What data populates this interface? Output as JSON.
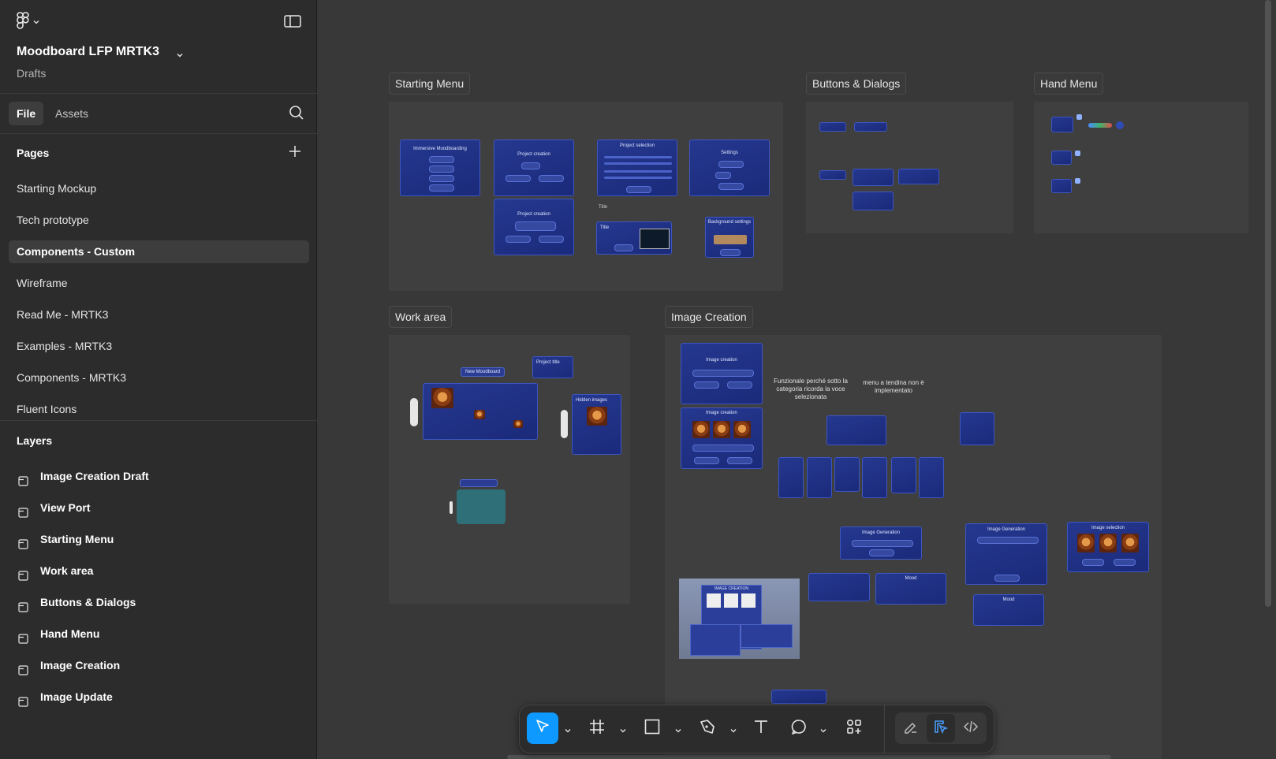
{
  "file": {
    "title": "Moodboard LFP MRTK3",
    "location": "Drafts"
  },
  "tabs": {
    "file": "File",
    "assets": "Assets"
  },
  "pages": {
    "heading": "Pages",
    "items": [
      "Starting Mockup",
      "Tech prototype",
      "Components - Custom",
      "Wireframe",
      "Read Me - MRTK3",
      "Examples - MRTK3",
      "Components -  MRTK3",
      "Fluent Icons"
    ],
    "selected": "Components - Custom"
  },
  "layers": {
    "heading": "Layers",
    "items": [
      "Image Creation Draft",
      "View Port",
      "Starting Menu",
      "Work area",
      "Buttons & Dialogs",
      "Hand Menu",
      "Image Creation",
      "Image Update"
    ]
  },
  "canvas": {
    "sections": {
      "starting_menu": "Starting Menu",
      "buttons_dialogs": "Buttons & Dialogs",
      "hand_menu": "Hand Menu",
      "work_area": "Work area",
      "image_creation": "Image Creation"
    },
    "frames": {
      "immersive": "Immersive Moodboarding",
      "project_creation": "Project creation",
      "project_selection": "Project selection",
      "settings": "Settings",
      "title": "Title",
      "background_settings": "Background settings",
      "new_moodboard": "New Moodboard",
      "project_title": "Project title",
      "hidden_images": "Hidden images",
      "image_creation": "Image creation",
      "image_generation": "Image Generation",
      "mood": "Mood",
      "image_selection": "Image selection",
      "image_creation_caps": "IMAGE CREATION"
    },
    "notes": {
      "functional": "Funzionale perché sotto la categoria ricorda la voce selezionata",
      "dropdown": "menu a tendina non è implementato"
    }
  },
  "toolbar": {
    "tools": [
      "move-tool",
      "frame-tool",
      "rectangle-tool",
      "pen-tool",
      "text-tool",
      "comment-tool",
      "actions-tool"
    ],
    "active_tool": "move-tool",
    "modes": [
      "draw-mode",
      "design-mode",
      "dev-mode"
    ],
    "active_mode": "design-mode"
  },
  "colors": {
    "accent": "#0d99ff",
    "sidebar_bg": "#2c2c2c",
    "canvas_bg": "#383838",
    "frame_blue": "#1f3189"
  }
}
